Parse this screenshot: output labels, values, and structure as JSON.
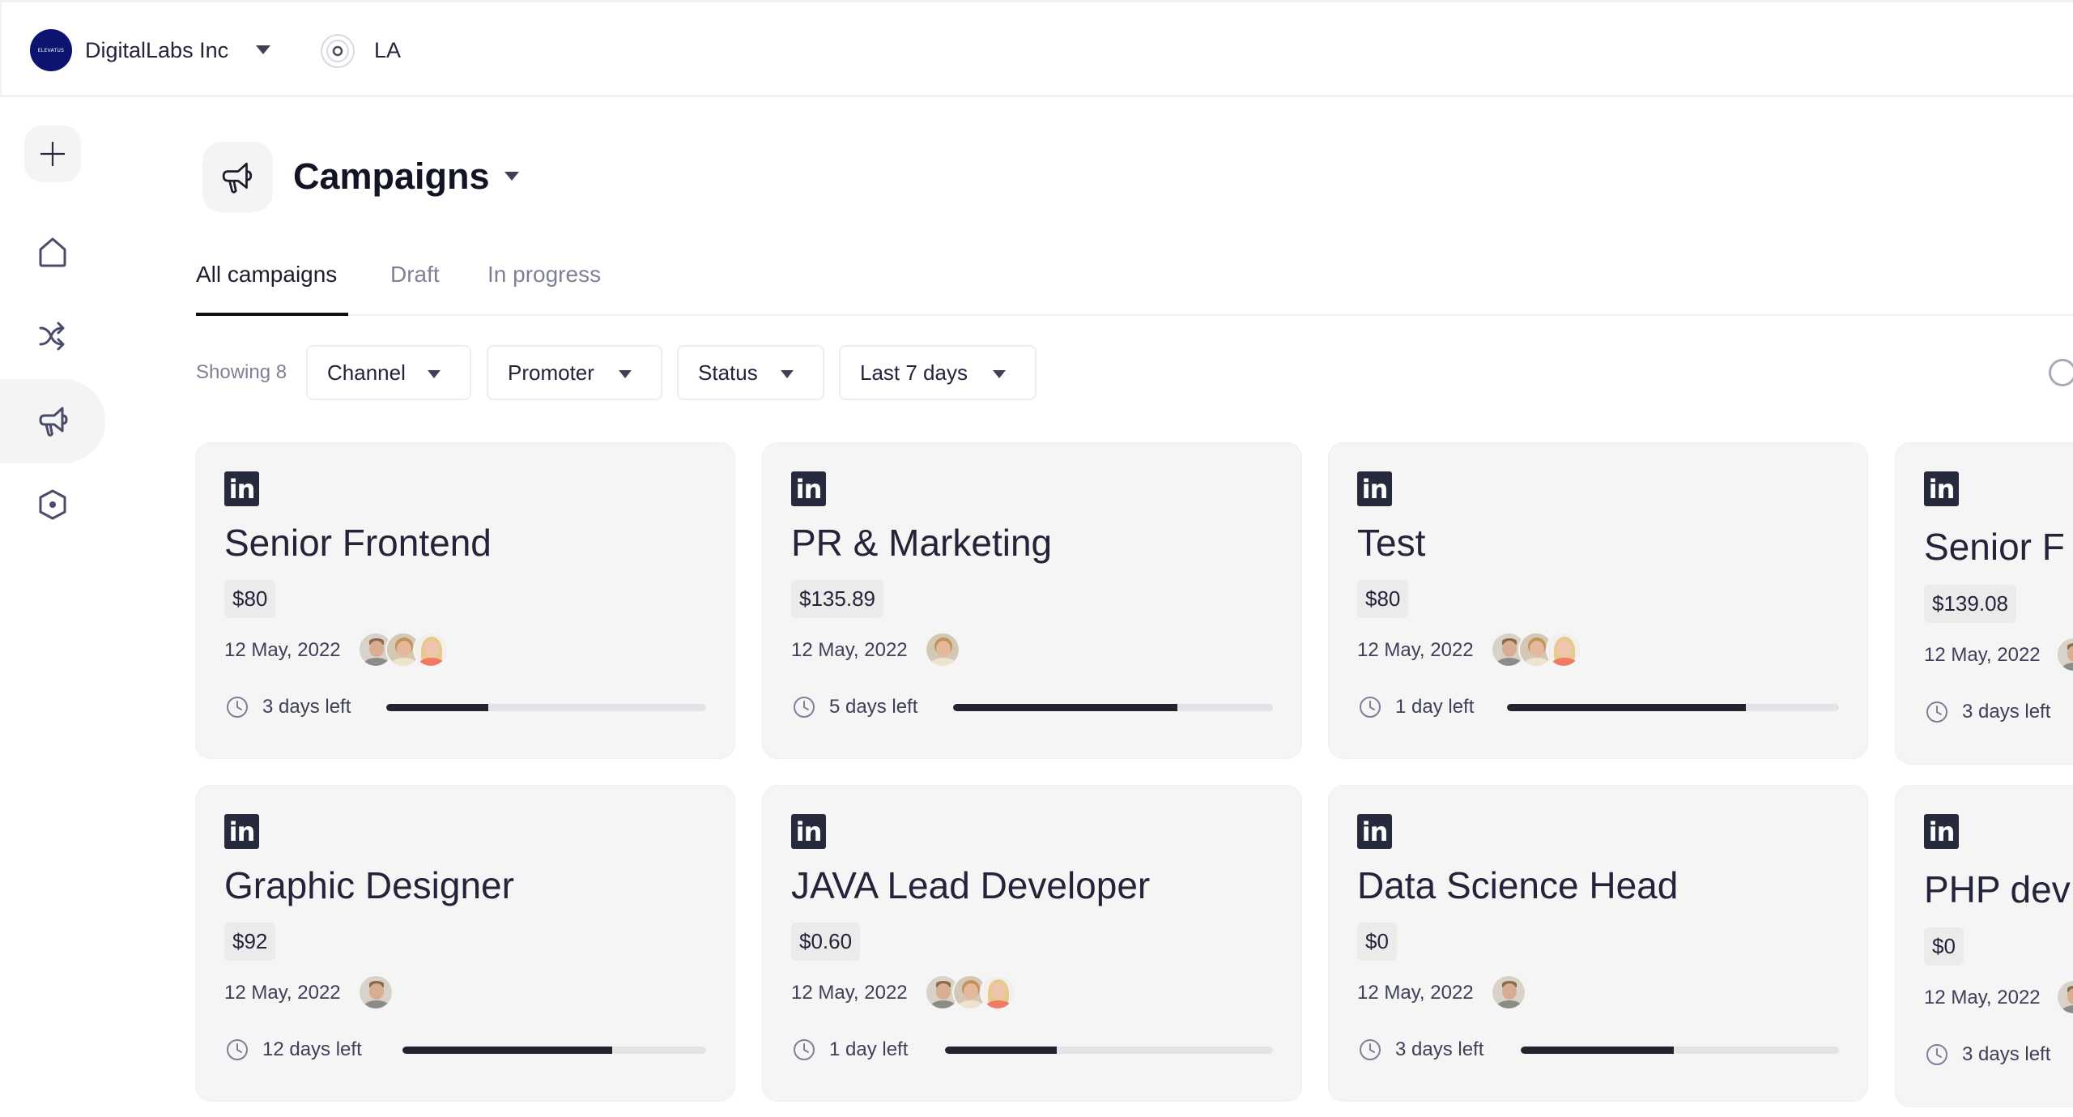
{
  "topbar": {
    "org_logo_text": "ELEVATUS",
    "org_name": "DigitalLabs Inc",
    "location": "LA"
  },
  "sidebar": {
    "items": [
      {
        "name": "add",
        "icon": "plus-icon",
        "active": false
      },
      {
        "name": "home",
        "icon": "home-icon",
        "active": false
      },
      {
        "name": "workflows",
        "icon": "shuffle-icon",
        "active": false
      },
      {
        "name": "campaigns",
        "icon": "megaphone-icon",
        "active": true
      },
      {
        "name": "settings",
        "icon": "hexagon-icon",
        "active": false
      }
    ]
  },
  "header": {
    "title": "Campaigns",
    "icon": "megaphone-icon"
  },
  "tabs": [
    {
      "label": "All campaigns",
      "active": true
    },
    {
      "label": "Draft",
      "active": false
    },
    {
      "label": "In progress",
      "active": false
    }
  ],
  "filters": {
    "showing": "Showing 8",
    "channel": "Channel",
    "promoter": "Promoter",
    "status": "Status",
    "date_range": "Last 7 days"
  },
  "campaigns": [
    {
      "channel": "linkedin",
      "title": "Senior Frontend",
      "budget": "$80",
      "date": "12 May, 2022",
      "promoters": [
        "m",
        "b",
        "r"
      ],
      "time_left": "3 days left",
      "progress": 0.32
    },
    {
      "channel": "linkedin",
      "title": "PR & Marketing",
      "budget": "$135.89",
      "date": "12 May, 2022",
      "promoters": [
        "b"
      ],
      "time_left": "5 days left",
      "progress": 0.7
    },
    {
      "channel": "linkedin",
      "title": "Test",
      "budget": "$80",
      "date": "12 May, 2022",
      "promoters": [
        "m",
        "b",
        "r"
      ],
      "time_left": "1 day left",
      "progress": 0.72
    },
    {
      "channel": "linkedin",
      "title": "Senior F",
      "budget": "$139.08",
      "date": "12 May, 2022",
      "promoters": [
        "m"
      ],
      "time_left": "3 days left",
      "progress": null
    },
    {
      "channel": "linkedin",
      "title": "Graphic Designer",
      "budget": "$92",
      "date": "12 May, 2022",
      "promoters": [
        "m"
      ],
      "time_left": "12 days left",
      "progress": 0.69
    },
    {
      "channel": "linkedin",
      "title": "JAVA Lead Developer",
      "budget": "$0.60",
      "date": "12 May, 2022",
      "promoters": [
        "m",
        "b",
        "r"
      ],
      "time_left": "1 day left",
      "progress": 0.34
    },
    {
      "channel": "linkedin",
      "title": "Data Science Head",
      "budget": "$0",
      "date": "12 May, 2022",
      "promoters": [
        "m"
      ],
      "time_left": "3 days left",
      "progress": 0.48
    },
    {
      "channel": "linkedin",
      "title": "PHP dev",
      "budget": "$0",
      "date": "12 May, 2022",
      "promoters": [
        "m"
      ],
      "time_left": "3 days left",
      "progress": null
    }
  ],
  "colors": {
    "accent": "#121426",
    "progress_fill": "#22232f",
    "progress_track": "#e3e3e8",
    "card_bg": "#f5f5f5",
    "logo_bg": "#0d1470"
  }
}
